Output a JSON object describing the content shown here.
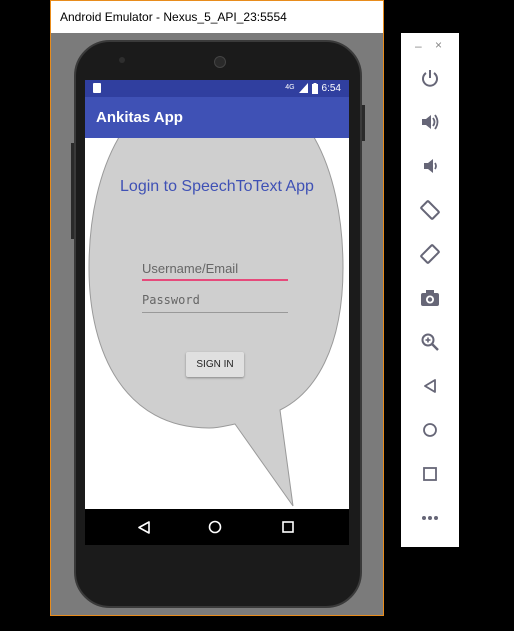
{
  "window": {
    "title": "Android Emulator - Nexus_5_API_23:5554"
  },
  "status_bar": {
    "time": "6:54",
    "signal": "4G"
  },
  "app": {
    "title": "Ankitas App",
    "login_heading": "Login to SpeechToText App",
    "username_placeholder": "Username/Email",
    "password_placeholder": "Password",
    "signin_label": "SIGN IN"
  },
  "colors": {
    "primary": "#3f51b5",
    "primary_dark": "#303f9f",
    "accent": "#ff4081",
    "bubble": "#cfcfcf"
  },
  "toolbar": {
    "minimize": "–",
    "close": "×",
    "buttons": [
      "power-icon",
      "volume-up-icon",
      "volume-down-icon",
      "rotate-left-icon",
      "rotate-right-icon",
      "camera-icon",
      "zoom-icon",
      "back-icon",
      "home-icon",
      "overview-icon",
      "more-icon"
    ]
  }
}
